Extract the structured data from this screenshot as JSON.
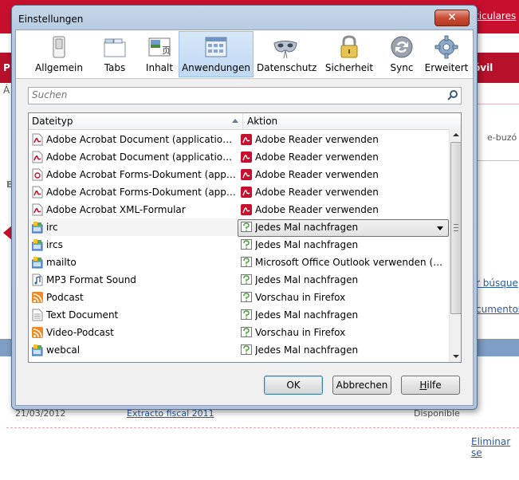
{
  "background": {
    "top_link": "ticulares",
    "nav_left": "P",
    "nav_right": "óvil",
    "side_text": "e-buzó",
    "left_a": "Á",
    "left_e": "E",
    "link_busq": "r búsque",
    "link_docs": "cumentos",
    "row": {
      "date": "21/03/2012",
      "document": "Extracto fiscal 2011",
      "status": "Disponible"
    },
    "delete_link": "Eliminar se"
  },
  "dialog": {
    "title": "Einstellungen",
    "close_label": "✕",
    "panes": [
      {
        "label": "Allgemein",
        "icon": "switch-icon"
      },
      {
        "label": "Tabs",
        "icon": "tabs-icon"
      },
      {
        "label": "Inhalt",
        "icon": "content-icon"
      },
      {
        "label": "Anwendungen",
        "icon": "applications-icon",
        "selected": true
      },
      {
        "label": "Datenschutz",
        "icon": "mask-icon"
      },
      {
        "label": "Sicherheit",
        "icon": "lock-icon"
      },
      {
        "label": "Sync",
        "icon": "sync-icon"
      },
      {
        "label": "Erweitert",
        "icon": "gear-icon"
      }
    ],
    "search_placeholder": "Suchen",
    "columns": {
      "type": "Dateityp",
      "action": "Aktion"
    },
    "rows": [
      {
        "type": "Adobe Acrobat Document (application/PD...",
        "action": "Adobe Reader  verwenden",
        "type_icon": "pdf-file-icon",
        "action_icon": "adobe-reader-icon"
      },
      {
        "type": "Adobe Acrobat Document (application/pdf)",
        "action": "Adobe Reader  verwenden",
        "type_icon": "pdf-file-icon",
        "action_icon": "adobe-reader-icon"
      },
      {
        "type": "Adobe Acrobat Forms-Dokument (applica...",
        "action": "Adobe Reader  verwenden",
        "type_icon": "pdf-form-icon",
        "action_icon": "adobe-reader-icon"
      },
      {
        "type": "Adobe Acrobat Forms-Dokument (applica...",
        "action": "Adobe Reader  verwenden",
        "type_icon": "pdf-file-icon",
        "action_icon": "adobe-reader-icon"
      },
      {
        "type": "Adobe Acrobat XML-Formular",
        "action": "Adobe Reader  verwenden",
        "type_icon": "pdf-file-icon",
        "action_icon": "adobe-reader-icon"
      },
      {
        "type": "irc",
        "action": "Jedes Mal nachfragen",
        "type_icon": "app-icon",
        "action_icon": "ask-icon",
        "dropdown": true
      },
      {
        "type": "ircs",
        "action": "Jedes Mal nachfragen",
        "type_icon": "app-icon",
        "action_icon": "ask-icon"
      },
      {
        "type": "mailto",
        "action": "Microsoft Office Outlook verwenden (Stan...",
        "type_icon": "app-icon",
        "action_icon": "ask-icon"
      },
      {
        "type": "MP3 Format Sound",
        "action": "Jedes Mal nachfragen",
        "type_icon": "audio-file-icon",
        "action_icon": "ask-icon"
      },
      {
        "type": "Podcast",
        "action": "Vorschau in Firefox",
        "type_icon": "rss-icon",
        "action_icon": "ask-icon"
      },
      {
        "type": "Text Document",
        "action": "Jedes Mal nachfragen",
        "type_icon": "text-file-icon",
        "action_icon": "ask-icon"
      },
      {
        "type": "Video-Podcast",
        "action": "Vorschau in Firefox",
        "type_icon": "rss-icon",
        "action_icon": "ask-icon"
      },
      {
        "type": "webcal",
        "action": "Jedes Mal nachfragen",
        "type_icon": "app-icon",
        "action_icon": "ask-icon"
      }
    ],
    "buttons": {
      "ok": "OK",
      "cancel": "Abbrechen",
      "help_first": "H",
      "help_rest": "ilfe"
    }
  }
}
